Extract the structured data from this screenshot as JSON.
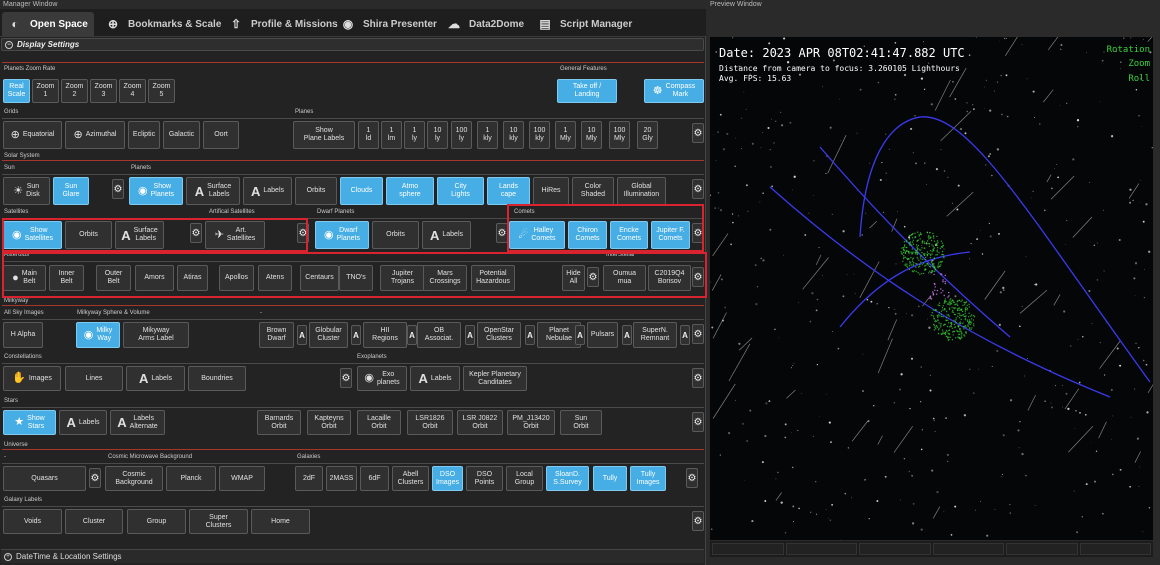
{
  "windows": {
    "manager": "Manager Window",
    "preview": "Preview Window"
  },
  "tabs": [
    {
      "label": "Open Space",
      "icon": "orbit-icon",
      "glyph": "◐"
    },
    {
      "label": "Bookmarks & Scale",
      "icon": "crosshair-icon",
      "glyph": "⊕"
    },
    {
      "label": "Profile & Missions",
      "icon": "rocket-icon",
      "glyph": "⇧"
    },
    {
      "label": "Shira Presenter",
      "icon": "globe-icon",
      "glyph": "◉"
    },
    {
      "label": "Data2Dome",
      "icon": "cloud-icon",
      "glyph": "☁"
    },
    {
      "label": "Script Manager",
      "icon": "document-icon",
      "glyph": "▤"
    }
  ],
  "display_settings": "Display Settings",
  "datetime_settings": "DateTime & Location Settings",
  "labels": {
    "zoom_rate": "Planets Zoom Rate",
    "general": "General Features",
    "grids": "Grids",
    "planes": "Planes",
    "solar": "Solar System",
    "sun": "Sun",
    "planets": "Planets",
    "satellites": "Satellites",
    "art_sat": "Artifical Satellites",
    "dwarf": "Dwarf Planets",
    "comets": "Comets",
    "asteroids": "Asteroids",
    "interstellar": "InterStellar",
    "milkyway": "Milkyway",
    "allsky": "All Sky Images",
    "mwsphere": "Milkyway Sphere & Volume",
    "dash": "-",
    "constellations": "Constellations",
    "exoplanets": "Exoplanets",
    "stars": "Stars",
    "universe": "Universe",
    "udash": "-",
    "cmb": "Cosmic Microwave Background",
    "galaxies": "Galaxies",
    "galaxy_labels": "Galaxy Labels"
  },
  "zoom": [
    "Real\nScale",
    "Zoom\n1",
    "Zoom\n2",
    "Zoom\n3",
    "Zoom\n4",
    "Zoom\n5"
  ],
  "general": [
    "Take off /\nLanding",
    "Compass\nMark"
  ],
  "grids": [
    "Equatorial",
    "Azimuthal",
    "Ecliptic",
    "Galactic",
    "Oort"
  ],
  "planes": [
    "Show\nPlane Labels",
    "1\nld",
    "1\nlm",
    "1\nly",
    "10\nly",
    "100\nly",
    "1\nkly",
    "10\nkly",
    "100\nkly",
    "1\nMly",
    "10\nMly",
    "100\nMly",
    "20\nGly"
  ],
  "sun": [
    "Sun\nDisk",
    "Sun\nGlare"
  ],
  "planets": [
    "Show\nPlanets",
    "Surface\nLabels",
    "Labels",
    "Orbits",
    "Clouds",
    "Atmo\nsphere",
    "City\nLights",
    "Lands\ncape",
    "HiRes",
    "Color\nShaded",
    "Global\nIllumination"
  ],
  "satellites": [
    "Show\nSatellites",
    "Orbits",
    "Surface\nLabels"
  ],
  "art_sat": [
    "Art.\nSatellites"
  ],
  "dwarf": [
    "Dwarf\nPlanets",
    "Orbits",
    "Labels"
  ],
  "comets": [
    "Halley\nComets",
    "Chiron\nComets",
    "Encke\nComets",
    "Jupiter F.\nComets"
  ],
  "asteroids": [
    "Main\nBelt",
    "Inner\nBelt",
    "Outer\nBelt",
    "Amors",
    "Atiras",
    "Apollos",
    "Atens",
    "Centaurs",
    "TNO's",
    "Jupiter\nTrojans",
    "Mars\nCrossings",
    "Potential\nHazardous",
    "Hide\nAll"
  ],
  "interstellar": [
    "Oumua\nmua",
    "C2019Q4\nBorisov"
  ],
  "allsky": [
    "H Alpha"
  ],
  "mwsphere": [
    "Milky\nWay",
    "Mikyway\nArms Label"
  ],
  "dsos": [
    "Brown\nDwarf",
    "Globular\nCluster",
    "HII\nRegions",
    "OB\nAssociat.",
    "OpenStar\nClusters",
    "Planet\nNebulae",
    "Pulsars",
    "SuperN.\nRemnant"
  ],
  "constellations": [
    "Images",
    "Lines",
    "Labels",
    "Boundries"
  ],
  "exoplanets": [
    "Exo\nplanets",
    "Labels",
    "Kepler Planetary\nCanditates"
  ],
  "stars": [
    "Show\nStars",
    "Labels",
    "Labels\nAlternate",
    "Barnards\nOrbit",
    "Kapteyns\nOrbit",
    "Lacaille\nOrbit",
    "LSR1826\nOrbit",
    "LSR J0822\nOrbit",
    "PM_J13420\nOrbit",
    "Sun\nOrbit"
  ],
  "universe": [
    "Quasars"
  ],
  "cmb": [
    "Cosmic\nBackground",
    "Planck",
    "WMAP"
  ],
  "galaxies": [
    "2dF",
    "2MASS",
    "6dF",
    "Abell\nClusters",
    "DSO\nImages",
    "DSO\nPoints",
    "Local\nGroup",
    "SloanD.\nS.Survey",
    "Tully",
    "Tully\nImages"
  ],
  "galaxy_labels": [
    "Voids",
    "Cluster",
    "Group",
    "Super\nClusters",
    "Home"
  ],
  "preview": {
    "date": "Date: 2023 APR 08T02:41:47.882 UTC",
    "distance": "Distance from camera to focus: 3.260105 Lighthours",
    "fps": "Avg. FPS: 15.63",
    "rotation": "Rotation",
    "zoom": "Zoom",
    "roll": "Roll"
  },
  "colors": {
    "active": "#46aee5",
    "highlight": "#d9232e",
    "overlay_green": "#39d33a",
    "orbit_blue": "#3a3af0"
  }
}
